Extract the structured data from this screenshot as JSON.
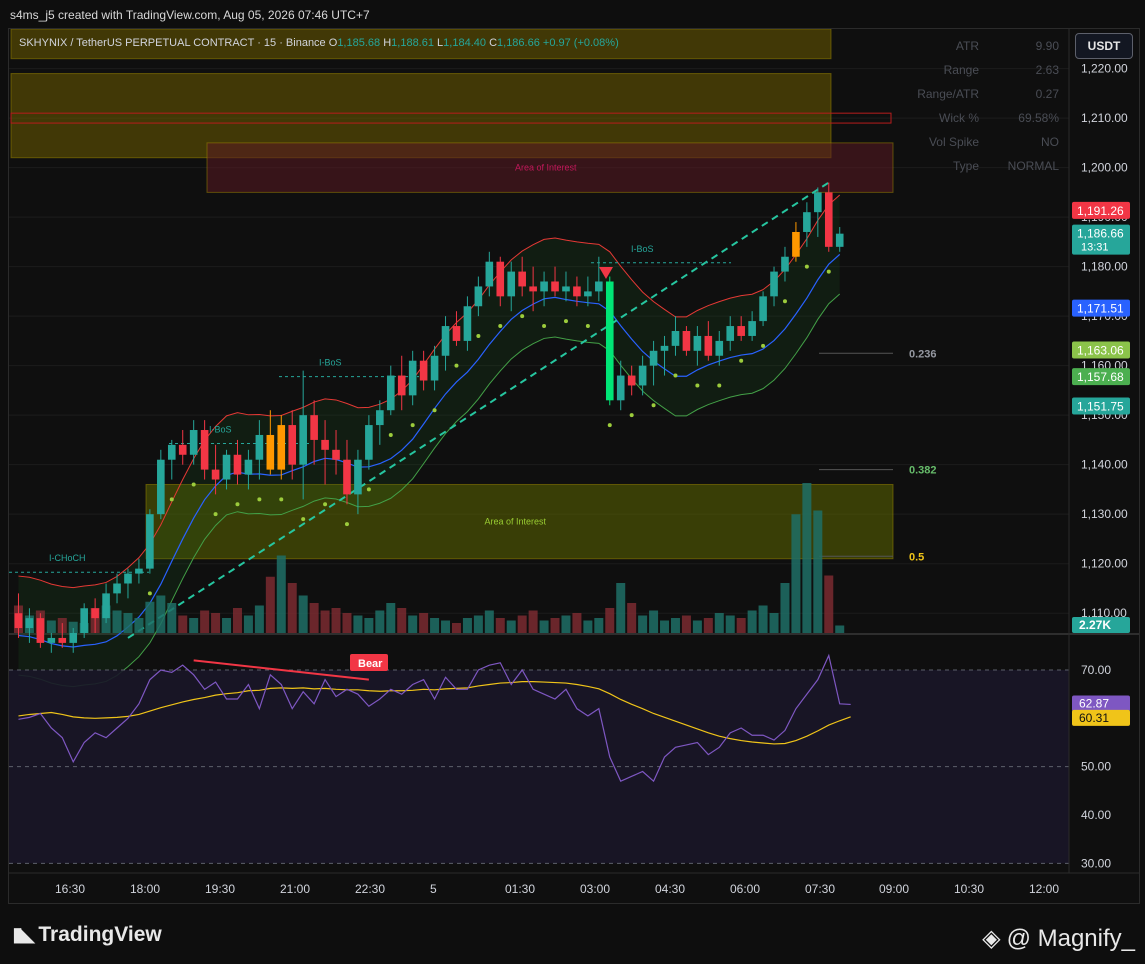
{
  "header": {
    "credit": "s4ms_j5 created with TradingView.com, Aug 05, 2026 07:46 UTC+7"
  },
  "legend": {
    "symbol": "SKHYNIX / TetherUS PERPETUAL CONTRACT · 15 · Binance",
    "o_label": "O",
    "o": "1,185.68",
    "h_label": "H",
    "h": "1,188.61",
    "l_label": "L",
    "l": "1,184.40",
    "c_label": "C",
    "c": "1,186.66",
    "chg": "+0.97 (+0.08%)"
  },
  "currency": "USDT",
  "atr_table": [
    {
      "label": "ATR",
      "value": "9.90"
    },
    {
      "label": "Range",
      "value": "2.63"
    },
    {
      "label": "Range/ATR",
      "value": "0.27"
    },
    {
      "label": "Wick %",
      "value": "69.58%"
    },
    {
      "label": "Vol Spike",
      "value": "NO"
    },
    {
      "label": "Type",
      "value": "NORMAL"
    }
  ],
  "colors": {
    "up": "#26a69a",
    "down": "#f23645",
    "accent_orange": "#ff9800",
    "bright_up": "#00e676",
    "ma_blue": "#2962ff",
    "fib_green": "#66bb6a",
    "rsi": "#7e57c2",
    "rsi_ma": "#f0c419"
  },
  "chart_data": {
    "type": "candlestick",
    "price_axis": {
      "ylim": [
        1106,
        1228
      ],
      "ticks": [
        1110,
        1120,
        1130,
        1140,
        1150,
        1160,
        1170,
        1180,
        1190,
        1200,
        1210,
        1220
      ],
      "tick_labels": [
        "1,110.00",
        "1,120.00",
        "1,130.00",
        "1,140.00",
        "1,150.00",
        "1,160.00",
        "1,170.00",
        "1,180.00",
        "1,190.00",
        "1,200.00",
        "1,210.00",
        "1,220.00"
      ]
    },
    "time_axis": {
      "labels": [
        "16:30",
        "18:00",
        "19:30",
        "21:00",
        "22:30",
        "5",
        "01:30",
        "03:00",
        "04:30",
        "06:00",
        "07:30",
        "09:00",
        "10:30",
        "12:00"
      ]
    },
    "price_badges": [
      {
        "value": 1191.26,
        "text": "1,191.26",
        "color": "#f23645"
      },
      {
        "value": 1186.66,
        "text": "1,186.66",
        "sub": "13:31",
        "color": "#26a69a"
      },
      {
        "value": 1171.51,
        "text": "1,171.51",
        "color": "#2962ff"
      },
      {
        "value": 1163.06,
        "text": "1,163.06",
        "color": "#8bc34a"
      },
      {
        "value": 1157.68,
        "text": "1,157.68",
        "color": "#4caf50"
      },
      {
        "value": 1151.75,
        "text": "1,151.75",
        "color": "#26a69a"
      }
    ],
    "volume_badge": "2.27K",
    "fib_levels": [
      {
        "label": "0.236",
        "value": 1162.5,
        "color": "#9598a1"
      },
      {
        "label": "0.382",
        "value": 1139.0,
        "color": "#66bb6a"
      },
      {
        "label": "0.5",
        "value": 1121.5,
        "color": "#f0c419"
      }
    ],
    "zones": [
      {
        "label": "",
        "top": 1228,
        "bottom": 1222,
        "color": "#6b5b00"
      },
      {
        "label": "",
        "top": 1219,
        "bottom": 1202,
        "color": "#6b5b00"
      },
      {
        "label": "Area of Interest",
        "top": 1205,
        "bottom": 1195,
        "color": "#5a1a22"
      },
      {
        "label": "Area of Interest",
        "top": 1136,
        "bottom": 1121,
        "color": "#5d6600"
      }
    ],
    "structure_labels": [
      {
        "text": "I-CHoCH",
        "price": 1120.5
      },
      {
        "text": "I-BoS",
        "price": 1146.5
      },
      {
        "text": "I-BoS",
        "price": 1160.0
      },
      {
        "text": "I-BoS",
        "price": 1183.0
      }
    ],
    "candles": [
      [
        1110,
        1114,
        1105,
        1107
      ],
      [
        1107,
        1111,
        1104,
        1109
      ],
      [
        1109,
        1110,
        1103,
        1104
      ],
      [
        1104,
        1106,
        1102,
        1105
      ],
      [
        1105,
        1108,
        1103,
        1104
      ],
      [
        1104,
        1107,
        1102,
        1106
      ],
      [
        1106,
        1112,
        1105,
        1111
      ],
      [
        1111,
        1113,
        1106,
        1109
      ],
      [
        1109,
        1116,
        1108,
        1114
      ],
      [
        1114,
        1118,
        1112,
        1116
      ],
      [
        1116,
        1119,
        1113,
        1118
      ],
      [
        1118,
        1121,
        1116,
        1119
      ],
      [
        1119,
        1131,
        1118,
        1130
      ],
      [
        1130,
        1143,
        1129,
        1141
      ],
      [
        1141,
        1145,
        1137,
        1144
      ],
      [
        1144,
        1147,
        1140,
        1142
      ],
      [
        1142,
        1149,
        1140,
        1147
      ],
      [
        1147,
        1149,
        1137,
        1139
      ],
      [
        1139,
        1144,
        1134,
        1137
      ],
      [
        1137,
        1143,
        1135,
        1142
      ],
      [
        1142,
        1145,
        1136,
        1138
      ],
      [
        1138,
        1143,
        1135,
        1141
      ],
      [
        1141,
        1149,
        1137,
        1146
      ],
      [
        1146,
        1151,
        1138,
        1139
      ],
      [
        1139,
        1150,
        1137,
        1148
      ],
      [
        1148,
        1151,
        1137,
        1140
      ],
      [
        1140,
        1159,
        1133,
        1150
      ],
      [
        1150,
        1153,
        1140,
        1145
      ],
      [
        1145,
        1149,
        1136,
        1143
      ],
      [
        1143,
        1147,
        1138,
        1141
      ],
      [
        1141,
        1145,
        1132,
        1134
      ],
      [
        1134,
        1143,
        1130,
        1141
      ],
      [
        1141,
        1150,
        1139,
        1148
      ],
      [
        1148,
        1153,
        1144,
        1151
      ],
      [
        1151,
        1160,
        1150,
        1158
      ],
      [
        1158,
        1162,
        1151,
        1154
      ],
      [
        1154,
        1163,
        1152,
        1161
      ],
      [
        1161,
        1163,
        1155,
        1157
      ],
      [
        1157,
        1164,
        1155,
        1162
      ],
      [
        1162,
        1170,
        1159,
        1168
      ],
      [
        1168,
        1171,
        1164,
        1165
      ],
      [
        1165,
        1174,
        1163,
        1172
      ],
      [
        1172,
        1178,
        1170,
        1176
      ],
      [
        1176,
        1183,
        1174,
        1181
      ],
      [
        1181,
        1182,
        1172,
        1174
      ],
      [
        1174,
        1181,
        1171,
        1179
      ],
      [
        1179,
        1182,
        1174,
        1176
      ],
      [
        1176,
        1180,
        1171,
        1175
      ],
      [
        1175,
        1179,
        1172,
        1177
      ],
      [
        1177,
        1180,
        1174,
        1175
      ],
      [
        1175,
        1179,
        1173,
        1176
      ],
      [
        1176,
        1178,
        1172,
        1174
      ],
      [
        1174,
        1178,
        1172,
        1175
      ],
      [
        1175,
        1182,
        1173,
        1177
      ],
      [
        1177,
        1178,
        1152,
        1153
      ],
      [
        1153,
        1161,
        1151,
        1158
      ],
      [
        1158,
        1160,
        1154,
        1156
      ],
      [
        1156,
        1162,
        1154,
        1160
      ],
      [
        1160,
        1165,
        1156,
        1163
      ],
      [
        1163,
        1166,
        1158,
        1164
      ],
      [
        1164,
        1170,
        1162,
        1167
      ],
      [
        1167,
        1168,
        1162,
        1163
      ],
      [
        1163,
        1168,
        1160,
        1166
      ],
      [
        1166,
        1169,
        1161,
        1162
      ],
      [
        1162,
        1167,
        1160,
        1165
      ],
      [
        1165,
        1170,
        1163,
        1168
      ],
      [
        1168,
        1170,
        1165,
        1166
      ],
      [
        1166,
        1171,
        1165,
        1169
      ],
      [
        1169,
        1175,
        1168,
        1174
      ],
      [
        1174,
        1180,
        1172,
        1179
      ],
      [
        1179,
        1184,
        1177,
        1182
      ],
      [
        1182,
        1189,
        1181,
        1187
      ],
      [
        1187,
        1193,
        1184,
        1191
      ],
      [
        1191,
        1196,
        1186,
        1195
      ],
      [
        1195,
        1197,
        1183,
        1184
      ],
      [
        1184,
        1188,
        1183,
        1186.66
      ]
    ],
    "volume": [
      22,
      14,
      18,
      10,
      12,
      9,
      8,
      20,
      22,
      18,
      16,
      12,
      25,
      30,
      24,
      14,
      12,
      18,
      16,
      12,
      20,
      14,
      22,
      45,
      62,
      40,
      30,
      24,
      18,
      20,
      16,
      14,
      12,
      18,
      24,
      20,
      14,
      16,
      12,
      10,
      8,
      12,
      14,
      18,
      12,
      10,
      14,
      18,
      10,
      12,
      14,
      16,
      10,
      12,
      20,
      40,
      24,
      14,
      18,
      10,
      12,
      14,
      10,
      12,
      16,
      14,
      12,
      18,
      22,
      16,
      40,
      95,
      120,
      98,
      46,
      6
    ],
    "rsi": {
      "ylim": [
        28,
        76
      ],
      "ticks": [
        30,
        40,
        50,
        60,
        70
      ],
      "tick_labels": [
        "30.00",
        "40.00",
        "50.00",
        "60.00",
        "70.00"
      ],
      "value_badge": "62.87",
      "ma_badge": "60.31",
      "divergence_label": "Bear",
      "values": [
        59.8,
        60.2,
        61.0,
        58.0,
        56.0,
        51.0,
        55.0,
        57.0,
        56.0,
        58.0,
        60.0,
        63.0,
        68.0,
        70.0,
        69.5,
        71.0,
        69.0,
        66.0,
        67.5,
        64.0,
        64.0,
        67.0,
        62.0,
        69.0,
        67.0,
        62.0,
        65.5,
        63.0,
        68.0,
        64.5,
        66.0,
        65.0,
        62.5,
        64.0,
        66.0,
        65.0,
        67.0,
        68.0,
        64.0,
        68.5,
        66.0,
        66.0,
        70.0,
        71.0,
        71.5,
        67.0,
        70.0,
        66.0,
        65.0,
        64.0,
        66.0,
        62.0,
        60.5,
        62.0,
        52.0,
        47.0,
        48.0,
        49.0,
        47.0,
        52.0,
        54.0,
        54.5,
        55.0,
        52.5,
        54.0,
        57.0,
        58.0,
        56.5,
        56.5,
        55.5,
        57.5,
        62.0,
        65.0,
        68.0,
        73.0,
        63.0,
        62.87
      ],
      "ma_values": [
        60.5,
        60.8,
        61.0,
        61.2,
        60.8,
        60.3,
        60.1,
        60.0,
        60.1,
        60.2,
        60.4,
        60.8,
        61.5,
        62.2,
        62.8,
        63.4,
        63.9,
        64.3,
        64.8,
        65.1,
        65.3,
        65.7,
        65.8,
        66.2,
        66.3,
        66.2,
        66.3,
        66.1,
        66.2,
        66.0,
        65.9,
        65.9,
        65.7,
        65.6,
        65.7,
        65.7,
        65.8,
        66.0,
        65.9,
        66.1,
        66.2,
        66.3,
        66.7,
        67.0,
        67.3,
        67.4,
        67.6,
        67.6,
        67.5,
        67.4,
        67.3,
        67.0,
        66.6,
        66.1,
        65.1,
        63.9,
        62.9,
        62.0,
        61.0,
        60.2,
        59.4,
        58.6,
        57.8,
        57.0,
        56.3,
        55.8,
        55.4,
        55.1,
        54.9,
        54.7,
        54.8,
        55.4,
        56.3,
        57.4,
        58.6,
        59.5,
        60.31
      ]
    }
  },
  "footer": {
    "brand": "TradingView",
    "watermark": "@ Magnify_"
  }
}
